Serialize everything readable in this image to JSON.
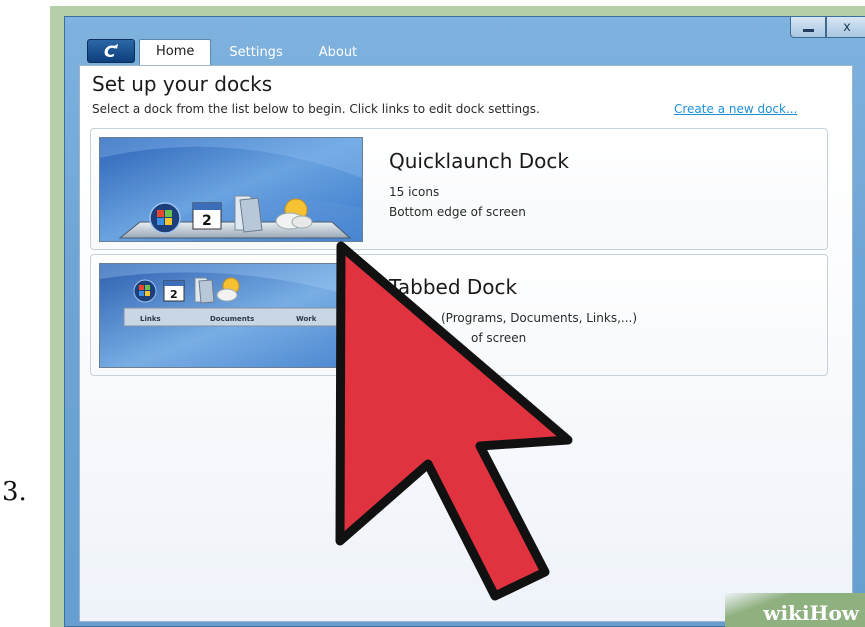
{
  "step": {
    "number": "3."
  },
  "app": {
    "logo_glyph": "C",
    "tabs": [
      {
        "label": "Home",
        "active": true
      },
      {
        "label": "Settings",
        "active": false
      },
      {
        "label": "About",
        "active": false
      }
    ],
    "window_controls": {
      "close_glyph": "x"
    }
  },
  "main": {
    "title": "Set up your docks",
    "instructions": "Select a dock from the list below to begin. Click links to edit dock settings.",
    "create_link": "Create a new dock..."
  },
  "docks": [
    {
      "name": "Quicklaunch Dock",
      "line1": "15 icons",
      "line2": "Bottom edge of screen",
      "thumb_calendar_day": "2"
    },
    {
      "name": "Tabbed Dock",
      "line1": "(Programs, Documents, Links,...)",
      "line2": "of screen",
      "thumb_calendar_day": "2",
      "thumb_tabs": [
        "Links",
        "Documents",
        "Work"
      ]
    }
  ],
  "watermark": {
    "part1": "wiki",
    "part2": "How"
  },
  "colors": {
    "accent_link": "#1e8fd8",
    "cursor_fill": "#e0323f",
    "cursor_outline": "#111111",
    "window_chrome": "#6fa5d6"
  },
  "icons": [
    "windows-start-icon",
    "calendar-icon",
    "documents-icon",
    "weather-icon",
    "mouse-cursor-icon",
    "minimize-icon",
    "close-icon"
  ]
}
